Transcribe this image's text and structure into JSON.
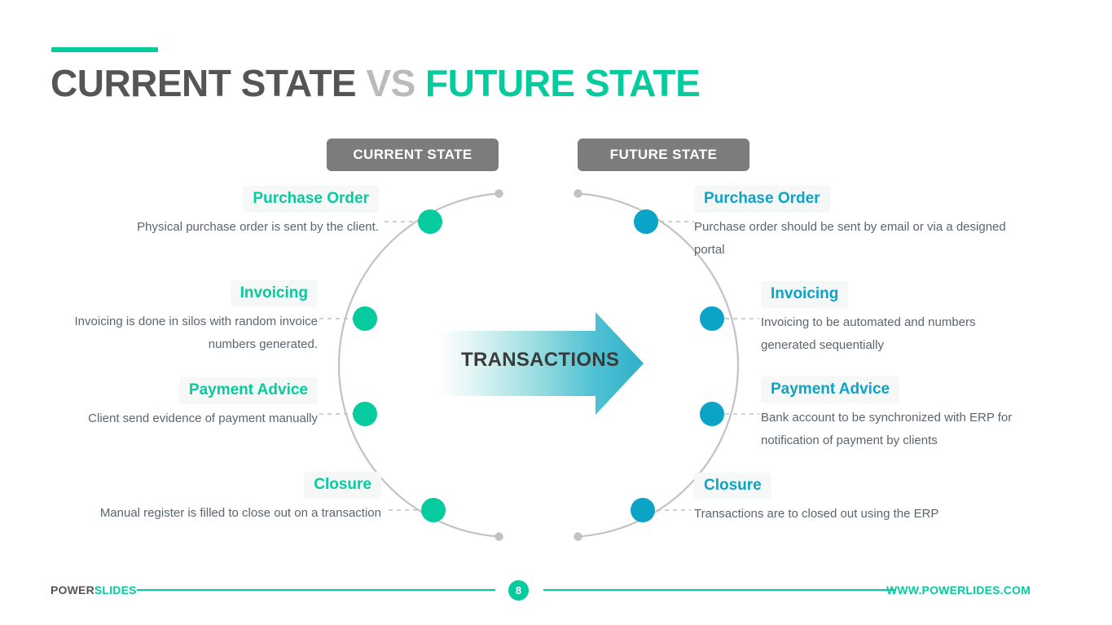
{
  "slide": {
    "title_parts": {
      "left": "CURRENT STATE ",
      "vs": "VS",
      "right": " FUTURE STATE"
    },
    "accent_color": "#00CC9B"
  },
  "columns": {
    "left_header": "CURRENT STATE",
    "right_header": "FUTURE STATE",
    "left_accent": "#06CB9E",
    "right_accent": "#0BA3C6"
  },
  "center": {
    "arrow_label": "TRANSACTIONS",
    "arrow_gradient_from": "#FFFFFF",
    "arrow_gradient_to": "#35B6CE"
  },
  "left_items": [
    {
      "title": "Purchase Order",
      "desc": "Physical purchase order is sent by the client."
    },
    {
      "title": "Invoicing",
      "desc": "Invoicing is done in silos with random invoice numbers generated."
    },
    {
      "title": "Payment Advice",
      "desc": "Client send evidence of payment manually"
    },
    {
      "title": "Closure",
      "desc": "Manual register is filled to close out on a transaction"
    }
  ],
  "right_items": [
    {
      "title": "Purchase Order",
      "desc": "Purchase order should be sent by email or via a designed portal"
    },
    {
      "title": "Invoicing",
      "desc": "Invoicing to be automated and numbers generated sequentially"
    },
    {
      "title": "Payment Advice",
      "desc": "Bank account to be synchronized with ERP for notification of payment by clients"
    },
    {
      "title": "Closure",
      "desc": "Transactions are to closed out using the ERP"
    }
  ],
  "footer": {
    "brand_1": "POWER",
    "brand_2": "SLIDES",
    "page_number": "8",
    "url": "WWW.POWERLIDES.COM",
    "rule_color": "#06CB9E"
  }
}
